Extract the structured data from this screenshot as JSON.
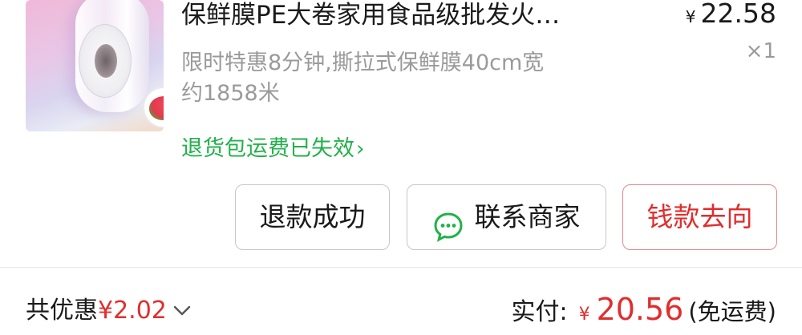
{
  "product": {
    "image_icon": "plastic-wrap-roll-image",
    "title": "保鲜膜PE大卷家用食品级批发火…",
    "price_currency": "¥",
    "price_amount": "22.58",
    "quantity": "×1",
    "description_line1": "限时特惠8分钟,撕拉式保鲜膜40cm宽",
    "description_line2": "约1858米",
    "return_link": "退货包运费已失效",
    "return_link_chevron": "›"
  },
  "actions": {
    "refund_label": "退款成功",
    "contact_label": "联系商家",
    "contact_icon": "chat-bubble-icon",
    "money_label": "钱款去向"
  },
  "summary": {
    "discount_label": "共优惠",
    "discount_amount": "¥2.02",
    "paid_label": "实付:",
    "paid_currency": "¥",
    "paid_amount": "20.56",
    "shipping_note": "(免运费)"
  },
  "colors": {
    "accent_red": "#e12d2d",
    "link_green": "#21b14a",
    "chat_icon_green": "#21b14a",
    "muted_gray": "#9a9a9a"
  }
}
